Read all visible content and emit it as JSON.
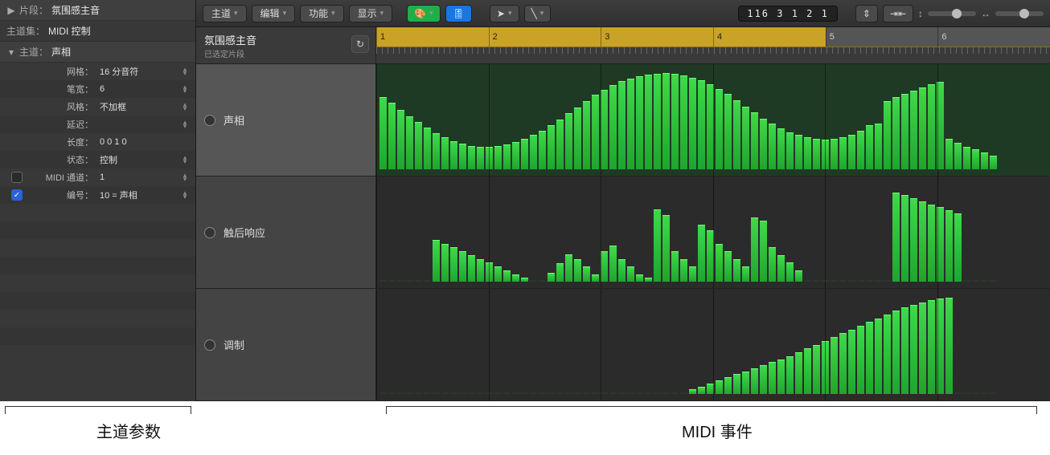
{
  "inspector": {
    "segment_label": "片段：",
    "segment_value": "氛围感主音",
    "channel_set_label": "主道集：",
    "channel_set_value": "MIDI 控制",
    "channel_label": "主道：",
    "channel_value": "声相",
    "params": [
      {
        "label": "网格：",
        "value": "16 分音符",
        "stepper": true
      },
      {
        "label": "笔宽：",
        "value": "6",
        "stepper": true
      },
      {
        "label": "风格：",
        "value": "不加框",
        "stepper": true
      },
      {
        "label": "延迟：",
        "value": "",
        "stepper": true
      },
      {
        "label": "长度：",
        "value": "0 0 1   0",
        "stepper": false
      },
      {
        "label": "状态：",
        "value": "控制",
        "stepper": true
      },
      {
        "label": "MIDI 通道：",
        "value": "1",
        "stepper": true,
        "check": "off"
      },
      {
        "label": "编号：",
        "value": "10 = 声相",
        "stepper": true,
        "check": "on"
      }
    ]
  },
  "toolbar": {
    "menus": [
      "主道",
      "编辑",
      "功能",
      "显示"
    ],
    "palette_icon": "palette-icon",
    "tuning_icon": "tuning-icon",
    "pointer_icon": "pointer-icon",
    "pencil_icon": "pencil-icon",
    "position": "116  3 1 2 1",
    "vzoom_icon": "vertical-zoom-icon",
    "fit_icon": "fit-horizontal-icon"
  },
  "region": {
    "title": "氛围感主音",
    "subtitle": "已选定片段",
    "loop_icon": "loop-icon"
  },
  "ruler": {
    "labels": [
      "1",
      "2",
      "3",
      "4",
      "5",
      "6"
    ]
  },
  "lanes": [
    {
      "name": "声相",
      "selected": true,
      "kind": "pan"
    },
    {
      "name": "触后响应",
      "selected": false,
      "kind": "aftertouch"
    },
    {
      "name": "调制",
      "selected": false,
      "kind": "mod"
    }
  ],
  "chart_data": [
    {
      "type": "bar",
      "title": "声相",
      "ylabel": "",
      "xlabel": "",
      "ylim": [
        0,
        127
      ],
      "values": [
        95,
        88,
        78,
        70,
        62,
        55,
        48,
        42,
        37,
        34,
        31,
        30,
        30,
        31,
        33,
        36,
        40,
        45,
        51,
        58,
        66,
        74,
        82,
        90,
        98,
        105,
        111,
        116,
        120,
        123,
        125,
        126,
        127,
        126,
        124,
        121,
        117,
        112,
        106,
        99,
        91,
        83,
        75,
        67,
        60,
        54,
        49,
        45,
        42,
        40,
        39,
        40,
        42,
        46,
        51,
        58,
        60,
        90,
        95,
        100,
        104,
        108,
        112,
        115,
        40,
        35,
        30,
        26,
        22,
        18
      ]
    },
    {
      "type": "bar",
      "title": "触后响应",
      "ylim": [
        0,
        127
      ],
      "values": [
        0,
        0,
        0,
        0,
        0,
        0,
        55,
        50,
        45,
        40,
        35,
        30,
        25,
        20,
        15,
        10,
        5,
        0,
        0,
        12,
        24,
        36,
        30,
        20,
        10,
        40,
        48,
        30,
        20,
        10,
        5,
        95,
        88,
        40,
        30,
        20,
        75,
        68,
        50,
        40,
        30,
        20,
        85,
        80,
        45,
        35,
        25,
        15,
        0,
        0,
        0,
        0,
        0,
        0,
        0,
        0,
        0,
        0,
        118,
        114,
        110,
        106,
        102,
        98,
        94,
        90,
        0,
        0,
        0,
        0
      ]
    },
    {
      "type": "bar",
      "title": "调制",
      "ylim": [
        0,
        127
      ],
      "values": [
        0,
        0,
        0,
        0,
        0,
        0,
        0,
        0,
        0,
        0,
        0,
        0,
        0,
        0,
        0,
        0,
        0,
        0,
        0,
        0,
        0,
        0,
        0,
        0,
        0,
        0,
        0,
        0,
        0,
        0,
        0,
        0,
        0,
        0,
        0,
        6,
        10,
        14,
        18,
        22,
        26,
        30,
        34,
        38,
        42,
        46,
        50,
        55,
        60,
        65,
        70,
        75,
        80,
        85,
        90,
        95,
        100,
        105,
        110,
        114,
        118,
        121,
        124,
        126,
        127,
        0,
        0,
        0,
        0,
        0
      ]
    }
  ],
  "annotations": {
    "left": "主道参数",
    "right": "MIDI 事件"
  }
}
